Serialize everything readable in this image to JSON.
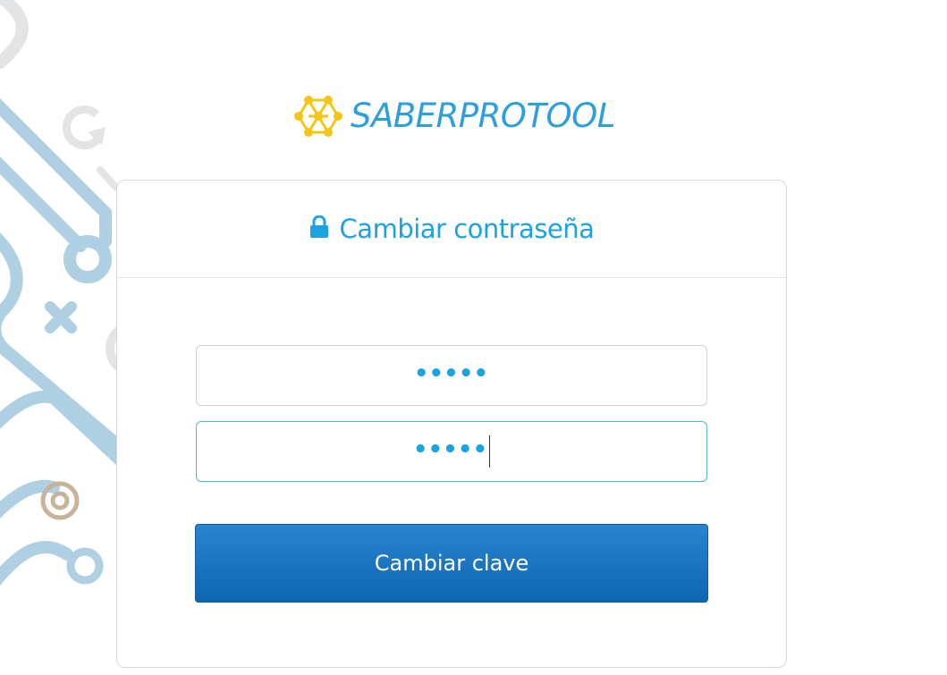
{
  "brand": {
    "name": "SABERPROTOOL",
    "logo_icon": "molecule-hexagon-icon",
    "logo_color": "#f5c518",
    "text_color": "#2d9fda"
  },
  "form": {
    "title": "Cambiar contraseña",
    "title_icon": "lock-icon",
    "accent_color": "#1aa3e0",
    "password_masked": "•••••",
    "confirm_masked": "•••••",
    "submit_label": "Cambiar clave",
    "button_color": "#1574c2"
  }
}
